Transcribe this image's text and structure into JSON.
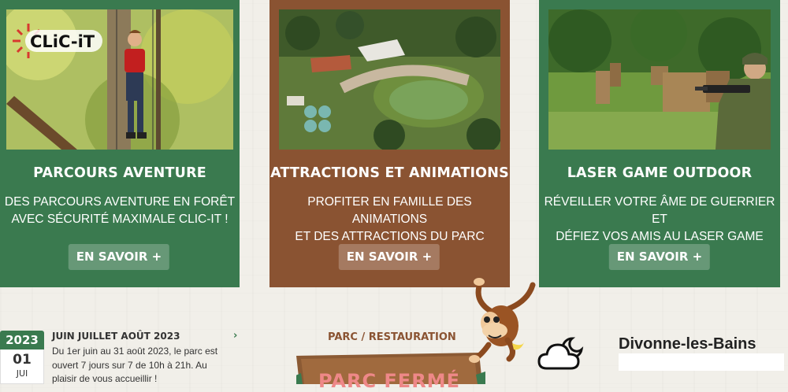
{
  "cards": [
    {
      "title": "PARCOURS AVENTURE",
      "text": "DES PARCOURS AVENTURE EN FORÊT\nAVEC SÉCURITÉ MAXIMALE CLIC-IT !",
      "button": "EN SAVOIR +",
      "logo": "CLiC-iT"
    },
    {
      "title": "ATTRACTIONS ET ANIMATIONS",
      "text": "PROFITER EN FAMILLE DES ANIMATIONS\nET DES ATTRACTIONS DU PARC",
      "button": "EN SAVOIR +"
    },
    {
      "title": "LASER GAME OUTDOOR",
      "text": "RÉVEILLER VOTRE ÂME DE GUERRIER ET\nDÉFIEZ VOS AMIS AU LASER GAME",
      "button": "EN SAVOIR +"
    }
  ],
  "news": {
    "year": "2023",
    "day": "01",
    "month": "JUI",
    "title": "JUIN JUILLET AOÛT 2023",
    "body": "Du 1er juin au 31 août 2023, le parc est ouvert 7 jours sur 7 de 10h à 21h. Au plaisir de vous accueillir !",
    "chevron": "›"
  },
  "status": {
    "label": "PARC / RESTAURATION",
    "sign": "PARC FERMÉ"
  },
  "weather": {
    "city": "Divonne-les-Bains",
    "icon": "cloud-moon-icon"
  },
  "colors": {
    "green": "#3a7a4f",
    "brown": "#8a5332"
  }
}
